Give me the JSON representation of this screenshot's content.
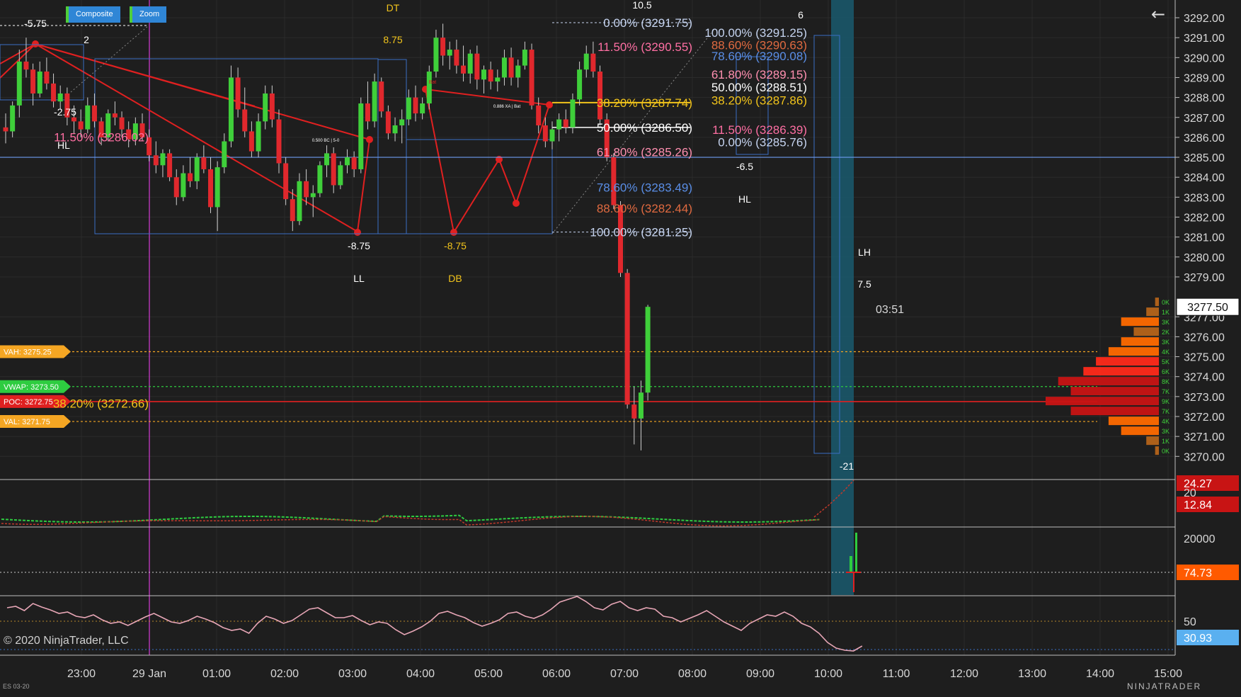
{
  "toolbar": {
    "composite_label": "Composite",
    "zoom_label": "Zoom"
  },
  "footer": {
    "copyright": "© 2020 NinjaTrader, LLC",
    "instrument": "ES 03-20",
    "brand": "NINJATRADER"
  },
  "back_icon": "arrow-left-icon",
  "colors": {
    "background": "#1e1e1e",
    "up": "#3fcf3a",
    "down": "#e0282d",
    "wick": "#cfcfcf",
    "grid": "#2b2b2b",
    "axis_text": "#d8d8d8",
    "price_box": "#ffffff"
  },
  "chart_data": {
    "type": "candlestick",
    "price_axis": {
      "range": [
        3269.5,
        3292.5
      ],
      "ticks": [
        "3292.00",
        "3291.00",
        "3290.00",
        "3289.00",
        "3288.00",
        "3287.00",
        "3286.00",
        "3285.00",
        "3284.00",
        "3283.00",
        "3282.00",
        "3281.00",
        "3280.00",
        "3279.00",
        "3277.00",
        "3276.00",
        "3275.00",
        "3274.00",
        "3273.00",
        "3272.00",
        "3271.00",
        "3270.00"
      ]
    },
    "time_axis": {
      "labels": [
        "23:00",
        "29 Jan",
        "01:00",
        "02:00",
        "03:00",
        "04:00",
        "05:00",
        "06:00",
        "07:00",
        "08:00",
        "09:00",
        "10:00",
        "11:00",
        "12:00",
        "13:00",
        "14:00",
        "15:00"
      ],
      "session_break": "29 Jan"
    },
    "current_price": "3277.50",
    "bar_timer": "03:51",
    "candles": [
      {
        "o": 3286.5,
        "h": 3287.2,
        "l": 3285.7,
        "c": 3286.3
      },
      {
        "o": 3286.3,
        "h": 3287.8,
        "l": 3286.0,
        "c": 3287.6
      },
      {
        "o": 3287.6,
        "h": 3290.4,
        "l": 3287.0,
        "c": 3289.8
      },
      {
        "o": 3289.8,
        "h": 3291.0,
        "l": 3289.0,
        "c": 3289.4
      },
      {
        "o": 3289.4,
        "h": 3289.7,
        "l": 3287.6,
        "c": 3288.2
      },
      {
        "o": 3288.2,
        "h": 3289.8,
        "l": 3288.0,
        "c": 3289.3
      },
      {
        "o": 3289.3,
        "h": 3290.0,
        "l": 3288.4,
        "c": 3288.7
      },
      {
        "o": 3288.7,
        "h": 3289.2,
        "l": 3287.5,
        "c": 3287.8
      },
      {
        "o": 3287.8,
        "h": 3288.6,
        "l": 3287.4,
        "c": 3288.2
      },
      {
        "o": 3288.2,
        "h": 3288.5,
        "l": 3286.6,
        "c": 3287.0
      },
      {
        "o": 3287.0,
        "h": 3287.6,
        "l": 3286.2,
        "c": 3286.8
      },
      {
        "o": 3286.8,
        "h": 3287.4,
        "l": 3286.0,
        "c": 3286.4
      },
      {
        "o": 3286.4,
        "h": 3288.0,
        "l": 3286.2,
        "c": 3287.6
      },
      {
        "o": 3287.6,
        "h": 3288.2,
        "l": 3286.5,
        "c": 3286.8
      },
      {
        "o": 3286.8,
        "h": 3287.0,
        "l": 3285.6,
        "c": 3286.0
      },
      {
        "o": 3286.0,
        "h": 3287.4,
        "l": 3285.8,
        "c": 3287.2
      },
      {
        "o": 3287.2,
        "h": 3287.8,
        "l": 3286.6,
        "c": 3287.0
      },
      {
        "o": 3287.0,
        "h": 3287.3,
        "l": 3286.0,
        "c": 3286.4
      },
      {
        "o": 3286.4,
        "h": 3286.8,
        "l": 3285.5,
        "c": 3285.9
      },
      {
        "o": 3285.9,
        "h": 3287.0,
        "l": 3285.6,
        "c": 3286.7
      },
      {
        "o": 3286.7,
        "h": 3287.2,
        "l": 3285.8,
        "c": 3286.0
      },
      {
        "o": 3286.0,
        "h": 3286.4,
        "l": 3284.8,
        "c": 3285.1
      },
      {
        "o": 3285.1,
        "h": 3285.8,
        "l": 3284.2,
        "c": 3284.6
      },
      {
        "o": 3284.6,
        "h": 3285.4,
        "l": 3284.0,
        "c": 3285.2
      },
      {
        "o": 3285.2,
        "h": 3285.4,
        "l": 3283.8,
        "c": 3284.0
      },
      {
        "o": 3284.0,
        "h": 3284.4,
        "l": 3282.6,
        "c": 3283.0
      },
      {
        "o": 3283.0,
        "h": 3284.6,
        "l": 3282.8,
        "c": 3284.2
      },
      {
        "o": 3284.2,
        "h": 3285.0,
        "l": 3283.5,
        "c": 3283.8
      },
      {
        "o": 3283.8,
        "h": 3285.2,
        "l": 3283.4,
        "c": 3285.0
      },
      {
        "o": 3285.0,
        "h": 3285.6,
        "l": 3284.2,
        "c": 3284.4
      },
      {
        "o": 3284.4,
        "h": 3285.0,
        "l": 3282.2,
        "c": 3282.5
      },
      {
        "o": 3282.5,
        "h": 3284.8,
        "l": 3281.3,
        "c": 3284.5
      },
      {
        "o": 3284.5,
        "h": 3286.2,
        "l": 3284.2,
        "c": 3285.8
      },
      {
        "o": 3285.8,
        "h": 3289.6,
        "l": 3285.5,
        "c": 3289.0
      },
      {
        "o": 3289.0,
        "h": 3289.5,
        "l": 3287.0,
        "c": 3287.4
      },
      {
        "o": 3287.4,
        "h": 3288.5,
        "l": 3286.0,
        "c": 3286.3
      },
      {
        "o": 3286.3,
        "h": 3286.8,
        "l": 3285.0,
        "c": 3285.3
      },
      {
        "o": 3285.3,
        "h": 3287.2,
        "l": 3285.0,
        "c": 3286.8
      },
      {
        "o": 3286.8,
        "h": 3288.6,
        "l": 3286.4,
        "c": 3288.2
      },
      {
        "o": 3288.2,
        "h": 3288.6,
        "l": 3286.5,
        "c": 3286.9
      },
      {
        "o": 3286.9,
        "h": 3287.4,
        "l": 3284.2,
        "c": 3284.7
      },
      {
        "o": 3284.7,
        "h": 3285.0,
        "l": 3282.6,
        "c": 3282.9
      },
      {
        "o": 3282.9,
        "h": 3283.4,
        "l": 3281.3,
        "c": 3281.8
      },
      {
        "o": 3281.8,
        "h": 3284.2,
        "l": 3281.6,
        "c": 3283.8
      },
      {
        "o": 3283.8,
        "h": 3284.4,
        "l": 3282.6,
        "c": 3283.0
      },
      {
        "o": 3283.0,
        "h": 3283.6,
        "l": 3282.0,
        "c": 3283.2
      },
      {
        "o": 3283.2,
        "h": 3284.8,
        "l": 3283.0,
        "c": 3284.6
      },
      {
        "o": 3284.6,
        "h": 3285.6,
        "l": 3284.0,
        "c": 3285.2
      },
      {
        "o": 3285.2,
        "h": 3285.5,
        "l": 3283.2,
        "c": 3283.6
      },
      {
        "o": 3283.6,
        "h": 3284.8,
        "l": 3283.4,
        "c": 3284.6
      },
      {
        "o": 3284.6,
        "h": 3285.4,
        "l": 3284.2,
        "c": 3285.0
      },
      {
        "o": 3285.0,
        "h": 3285.3,
        "l": 3284.0,
        "c": 3284.4
      },
      {
        "o": 3284.4,
        "h": 3288.0,
        "l": 3284.2,
        "c": 3287.7
      },
      {
        "o": 3287.7,
        "h": 3288.8,
        "l": 3286.4,
        "c": 3286.8
      },
      {
        "o": 3286.8,
        "h": 3289.2,
        "l": 3286.5,
        "c": 3288.8
      },
      {
        "o": 3288.8,
        "h": 3289.0,
        "l": 3287.0,
        "c": 3287.3
      },
      {
        "o": 3287.3,
        "h": 3287.6,
        "l": 3285.9,
        "c": 3286.2
      },
      {
        "o": 3286.2,
        "h": 3287.0,
        "l": 3285.8,
        "c": 3286.6
      },
      {
        "o": 3286.6,
        "h": 3287.4,
        "l": 3285.7,
        "c": 3286.9
      },
      {
        "o": 3286.9,
        "h": 3288.4,
        "l": 3286.6,
        "c": 3288.0
      },
      {
        "o": 3288.0,
        "h": 3288.6,
        "l": 3286.8,
        "c": 3287.2
      },
      {
        "o": 3287.2,
        "h": 3288.0,
        "l": 3286.9,
        "c": 3287.7
      },
      {
        "o": 3287.7,
        "h": 3289.6,
        "l": 3287.4,
        "c": 3289.3
      },
      {
        "o": 3289.3,
        "h": 3291.4,
        "l": 3289.0,
        "c": 3291.0
      },
      {
        "o": 3291.0,
        "h": 3291.7,
        "l": 3289.6,
        "c": 3290.1
      },
      {
        "o": 3290.1,
        "h": 3290.8,
        "l": 3289.4,
        "c": 3290.4
      },
      {
        "o": 3290.4,
        "h": 3290.9,
        "l": 3289.2,
        "c": 3289.6
      },
      {
        "o": 3289.6,
        "h": 3290.6,
        "l": 3288.8,
        "c": 3289.2
      },
      {
        "o": 3289.2,
        "h": 3290.4,
        "l": 3288.7,
        "c": 3290.2
      },
      {
        "o": 3290.2,
        "h": 3290.6,
        "l": 3288.4,
        "c": 3288.9
      },
      {
        "o": 3288.9,
        "h": 3289.6,
        "l": 3288.2,
        "c": 3289.4
      },
      {
        "o": 3289.4,
        "h": 3289.8,
        "l": 3288.4,
        "c": 3288.8
      },
      {
        "o": 3288.8,
        "h": 3289.4,
        "l": 3288.3,
        "c": 3289.0
      },
      {
        "o": 3289.0,
        "h": 3290.4,
        "l": 3288.6,
        "c": 3290.0
      },
      {
        "o": 3290.0,
        "h": 3290.5,
        "l": 3288.6,
        "c": 3289.0
      },
      {
        "o": 3289.0,
        "h": 3289.9,
        "l": 3288.5,
        "c": 3289.6
      },
      {
        "o": 3289.6,
        "h": 3290.8,
        "l": 3289.4,
        "c": 3290.4
      },
      {
        "o": 3290.4,
        "h": 3290.7,
        "l": 3287.4,
        "c": 3287.6
      },
      {
        "o": 3287.6,
        "h": 3288.0,
        "l": 3286.2,
        "c": 3286.6
      },
      {
        "o": 3286.6,
        "h": 3287.0,
        "l": 3285.5,
        "c": 3285.8
      },
      {
        "o": 3285.8,
        "h": 3286.8,
        "l": 3285.4,
        "c": 3286.4
      },
      {
        "o": 3286.4,
        "h": 3287.2,
        "l": 3285.8,
        "c": 3286.9
      },
      {
        "o": 3286.9,
        "h": 3287.4,
        "l": 3286.2,
        "c": 3286.5
      },
      {
        "o": 3286.5,
        "h": 3288.2,
        "l": 3286.2,
        "c": 3287.9
      },
      {
        "o": 3287.9,
        "h": 3289.8,
        "l": 3287.6,
        "c": 3289.4
      },
      {
        "o": 3289.4,
        "h": 3290.6,
        "l": 3289.0,
        "c": 3290.2
      },
      {
        "o": 3290.2,
        "h": 3290.8,
        "l": 3289.0,
        "c": 3289.3
      },
      {
        "o": 3289.3,
        "h": 3289.6,
        "l": 3286.6,
        "c": 3286.9
      },
      {
        "o": 3286.9,
        "h": 3287.2,
        "l": 3284.8,
        "c": 3285.0
      },
      {
        "o": 3285.0,
        "h": 3285.2,
        "l": 3282.4,
        "c": 3282.6
      },
      {
        "o": 3282.6,
        "h": 3282.8,
        "l": 3279.0,
        "c": 3279.2
      },
      {
        "o": 3279.2,
        "h": 3279.4,
        "l": 3272.4,
        "c": 3272.6
      },
      {
        "o": 3272.6,
        "h": 3273.5,
        "l": 3270.6,
        "c": 3271.9
      },
      {
        "o": 3271.9,
        "h": 3273.8,
        "l": 3270.3,
        "c": 3273.2
      },
      {
        "o": 3273.2,
        "h": 3277.6,
        "l": 3272.8,
        "c": 3277.5
      }
    ],
    "levels": [
      {
        "label": "VAH: 3275.25",
        "price": 3275.25,
        "color": "#f5a623"
      },
      {
        "label": "VWAP: 3273.50",
        "price": 3273.5,
        "color": "#2ecc40"
      },
      {
        "label": "POC: 3272.75",
        "price": 3272.75,
        "color": "#e02020"
      },
      {
        "label": "VAL: 3271.75",
        "price": 3271.75,
        "color": "#f5a623"
      }
    ],
    "fib_labels": [
      {
        "text": "0.00% (3291.75)",
        "price": 3291.75,
        "color": "#c6d4f0",
        "bar": 73
      },
      {
        "text": "11.50% (3290.55)",
        "price": 3290.55,
        "color": "#ff6fa3",
        "bar": 73
      },
      {
        "text": "38.20% (3287.74)",
        "price": 3287.74,
        "color": "#f2c41b",
        "bar": 73
      },
      {
        "text": "50.00% (3286.50)",
        "price": 3286.5,
        "color": "#ffffff",
        "bar": 73
      },
      {
        "text": "61.80% (3285.26)",
        "price": 3285.26,
        "color": "#ff8fb0",
        "bar": 73
      },
      {
        "text": "78.60% (3283.49)",
        "price": 3283.49,
        "color": "#5a8ee6",
        "bar": 73
      },
      {
        "text": "88.60% (3282.44)",
        "price": 3282.44,
        "color": "#e06a40",
        "bar": 73
      },
      {
        "text": "100.00% (3281.25)",
        "price": 3281.25,
        "color": "#c6d4f0",
        "bar": 73
      },
      {
        "text": "100.00% (3291.25)",
        "price": 3291.25,
        "color": "#c6d4f0",
        "bar": 86
      },
      {
        "text": "88.60% (3290.63)",
        "price": 3290.63,
        "color": "#e06a40",
        "bar": 86
      },
      {
        "text": "78.60% (3290.08)",
        "price": 3290.08,
        "color": "#5a8ee6",
        "bar": 86
      },
      {
        "text": "61.80% (3289.15)",
        "price": 3289.15,
        "color": "#ff8fb0",
        "bar": 86
      },
      {
        "text": "50.00% (3288.51)",
        "price": 3288.51,
        "color": "#ffffff",
        "bar": 86
      },
      {
        "text": "38.20% (3287.86)",
        "price": 3287.86,
        "color": "#f2c41b",
        "bar": 86
      },
      {
        "text": "11.50% (3286.39)",
        "price": 3286.39,
        "color": "#ff6fa3",
        "bar": 86
      },
      {
        "text": "0.00% (3285.76)",
        "price": 3285.76,
        "color": "#c6d4f0",
        "bar": 86
      },
      {
        "text": "11.50% (3286.02)",
        "price": 3286.02,
        "color": "#ff6fa3",
        "bar": 10
      },
      {
        "text": "38.20% (3272.66)",
        "price": 3272.66,
        "color": "#f2c41b",
        "bar": 10
      }
    ],
    "swing_labels": [
      {
        "text": "-5.75",
        "color": "#ffffff"
      },
      {
        "text": "2",
        "color": "#ffffff"
      },
      {
        "text": "-2.75",
        "color": "#ffffff"
      },
      {
        "text": "HL",
        "color": "#ffffff"
      },
      {
        "text": "DT",
        "color": "#f2c41b"
      },
      {
        "text": "8.75",
        "color": "#f2c41b"
      },
      {
        "text": "-8.75",
        "color": "#ffffff"
      },
      {
        "text": "LL",
        "color": "#ffffff"
      },
      {
        "text": "-8.75",
        "color": "#f2c41b"
      },
      {
        "text": "DB",
        "color": "#f2c41b"
      },
      {
        "text": "10.5",
        "color": "#ffffff"
      },
      {
        "text": "6",
        "color": "#ffffff"
      },
      {
        "text": "-6.5",
        "color": "#ffffff"
      },
      {
        "text": "HL",
        "color": "#ffffff"
      },
      {
        "text": "LH",
        "color": "#ffffff"
      },
      {
        "text": "7.5",
        "color": "#ffffff"
      },
      {
        "text": "-21",
        "color": "#ffffff"
      }
    ],
    "pattern_labels": [
      "Bat",
      "0.886 XA | Bat",
      "0.500 BC | 5-0"
    ],
    "volume_profile": {
      "labels": [
        "0K",
        "1K",
        "3K",
        "2K",
        "3K",
        "4K",
        "5K",
        "6K",
        "8K",
        "7K",
        "9K",
        "7K",
        "4K",
        "3K",
        "1K",
        "0K"
      ],
      "values": [
        0.3,
        1,
        3,
        2,
        3,
        4,
        5,
        6,
        8,
        7,
        9,
        7,
        4,
        3,
        1,
        0.3
      ]
    },
    "panels": [
      {
        "name": "oscillator",
        "readouts": [
          "24.27",
          "20",
          "12.84"
        ]
      },
      {
        "name": "volume",
        "readouts": [
          "20000",
          "74.73"
        ]
      },
      {
        "name": "rsi",
        "readouts": [
          "50",
          "30.93"
        ]
      }
    ]
  }
}
